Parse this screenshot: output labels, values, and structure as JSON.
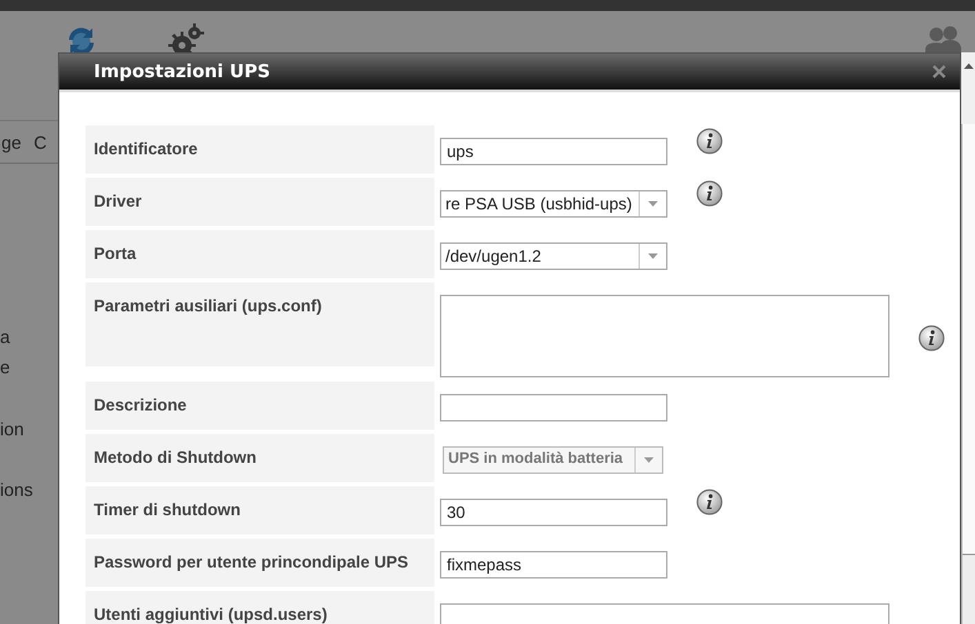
{
  "nav": {
    "items": [
      "ge",
      "C"
    ]
  },
  "sidebar": {
    "items": [
      "a",
      "e",
      "ion",
      "ions"
    ]
  },
  "dialog": {
    "title": "Impostazioni UPS",
    "rows": [
      {
        "label": "Identificatore",
        "kind": "text",
        "value": "ups",
        "info": true,
        "disabled": false
      },
      {
        "label": "Driver",
        "kind": "select",
        "value": "re PSA USB (usbhid-ups)",
        "info": true,
        "disabled": false
      },
      {
        "label": "Porta",
        "kind": "select",
        "value": "/dev/ugen1.2",
        "info": false,
        "disabled": false
      },
      {
        "label": "Parametri ausiliari (ups.conf)",
        "kind": "textarea",
        "value": "",
        "info": true,
        "disabled": false
      },
      {
        "label": "Descrizione",
        "kind": "text",
        "value": "",
        "info": false,
        "disabled": false
      },
      {
        "label": "Metodo di Shutdown",
        "kind": "select",
        "value": "UPS in modalità batteria",
        "info": false,
        "disabled": true
      },
      {
        "label": "Timer di shutdown",
        "kind": "text",
        "value": "30",
        "info": true,
        "disabled": false
      },
      {
        "label": "Password per utente princondipale UPS",
        "kind": "text",
        "value": "fixmepass",
        "info": false,
        "disabled": false
      },
      {
        "label": "Utenti aggiuntivi (upsd.users)",
        "kind": "textarea",
        "value": "",
        "info": false,
        "disabled": false
      }
    ]
  }
}
